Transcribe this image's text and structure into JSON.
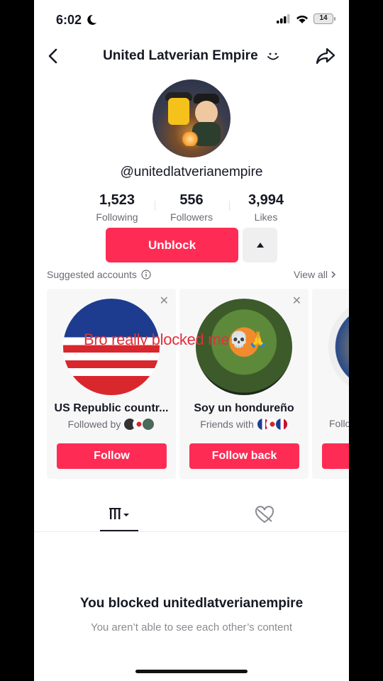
{
  "status": {
    "time": "6:02",
    "battery": "14"
  },
  "header": {
    "title": "United Latverian Empire"
  },
  "profile": {
    "handle": "@unitedlatverianempire",
    "stats": [
      {
        "value": "1,523",
        "label": "Following"
      },
      {
        "value": "556",
        "label": "Followers"
      },
      {
        "value": "3,994",
        "label": "Likes"
      }
    ],
    "unblock_label": "Unblock"
  },
  "suggested": {
    "title": "Suggested accounts",
    "view_all": "View all",
    "cards": [
      {
        "name": "US Republic countr...",
        "sub": "Followed by",
        "button": "Follow"
      },
      {
        "name": "Soy un hondureño",
        "sub": "Friends with",
        "button": "Follow back"
      },
      {
        "name": "",
        "sub": "Follo",
        "button": ""
      }
    ]
  },
  "overlay_text": "Bro really blocked me💀🙏",
  "blocked": {
    "title": "You blocked unitedlatverianempire",
    "subtitle": "You aren’t able to see each other’s content"
  },
  "colors": {
    "accent": "#fe2c55",
    "overlay": "#e0313c"
  }
}
